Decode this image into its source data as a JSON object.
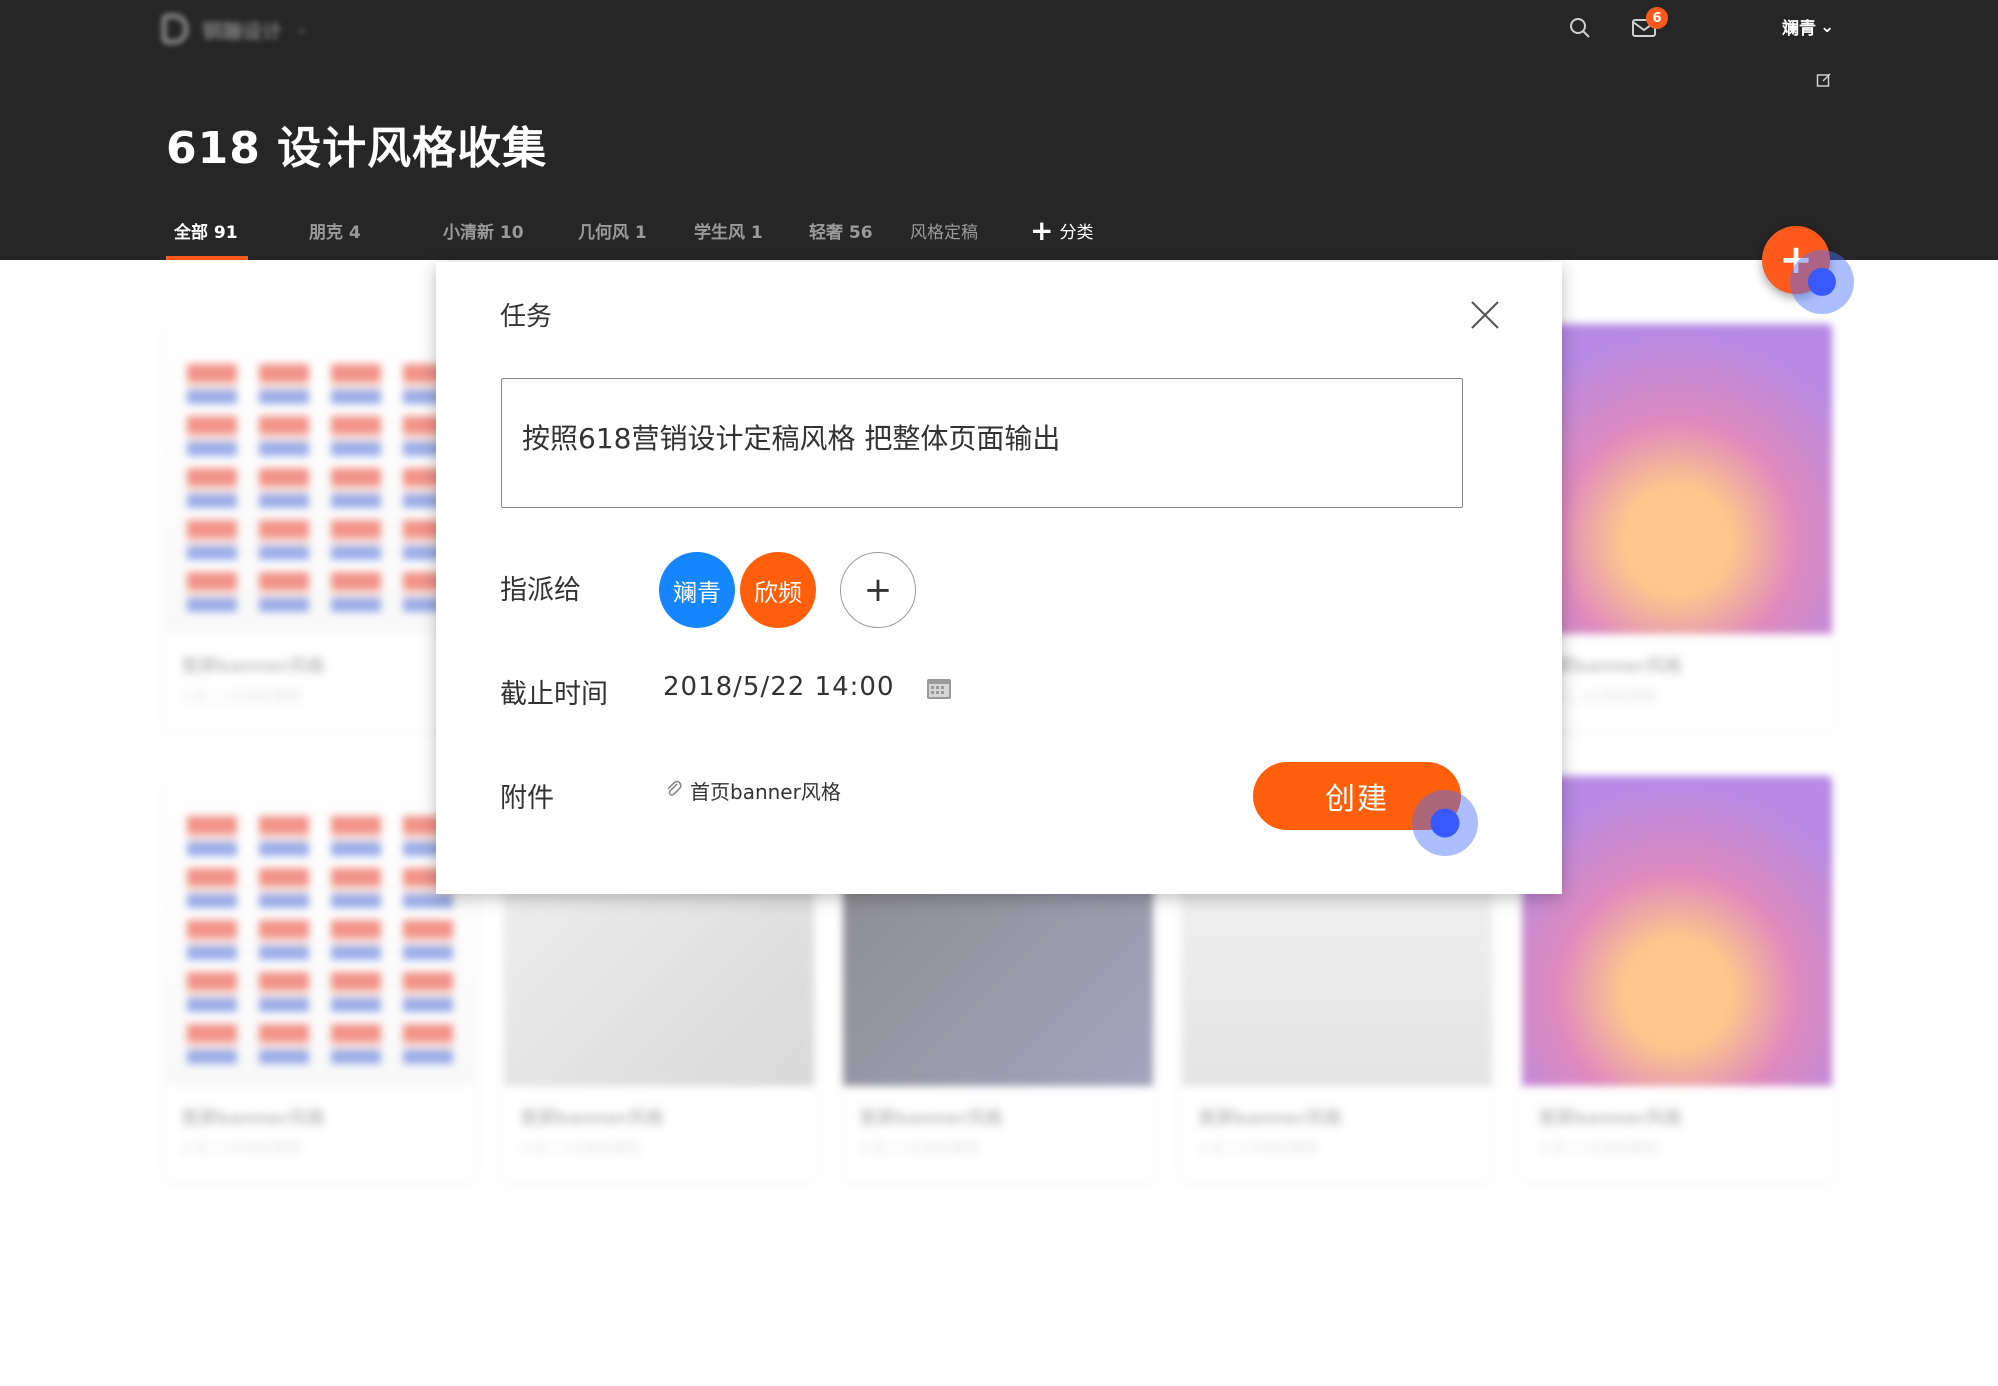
{
  "header": {
    "brand_name": "钢蹦设计",
    "notification_count": "6",
    "user_name": "斓青",
    "user_caret": "⌄",
    "page_title": "618 设计风格收集"
  },
  "tabs": [
    {
      "label": "全部 91",
      "active": true
    },
    {
      "label": "朋克 4"
    },
    {
      "label": "小清新 10"
    },
    {
      "label": "几何风 1"
    },
    {
      "label": "学生风 1"
    },
    {
      "label": "轻奢 56"
    },
    {
      "label": "风格定稿"
    },
    {
      "label": "分类",
      "icon": "plus-icon"
    }
  ],
  "fab": {
    "symbol": "+"
  },
  "cards": [
    {
      "title": "首屏banner风格",
      "meta": "小瓜 | 1分钟前更新",
      "thumb": "poster"
    },
    {
      "title": "首屏banner风格",
      "meta": "小瓜 | 1分钟前更新",
      "thumb": "promo"
    },
    {
      "title": "首屏banner风格",
      "meta": "小瓜 | 1分钟前更新",
      "thumb": "poster"
    },
    {
      "title": "首屏banner风格",
      "meta": "小瓜 | 1分钟前更新",
      "thumb": "desk"
    },
    {
      "title": "首屏banner风格",
      "meta": "小瓜 | 1分钟前更新",
      "thumb": "phone"
    },
    {
      "title": "首屏banner风格",
      "meta": "小瓜 | 1分钟前更新",
      "thumb": "mock"
    },
    {
      "title": "首屏banner风格",
      "meta": "小瓜 | 1分钟前更新",
      "thumb": "promo"
    }
  ],
  "modal": {
    "title": "任务",
    "task_text": "按照618营销设计定稿风格 把整体页面输出",
    "assign_label": "指派给",
    "assignees": [
      "斓青",
      "欣频"
    ],
    "add_symbol": "+",
    "deadline_label": "截止时间",
    "deadline_value": "2018/5/22  14:00",
    "attachment_label": "附件",
    "attachment_name": "首页banner风格",
    "create_label": "创建"
  },
  "colors": {
    "accent": "#ff5f0a",
    "header_bg": "#262626",
    "assignee_blue": "#1686ff",
    "touch_indicator": "#3a58ff"
  }
}
